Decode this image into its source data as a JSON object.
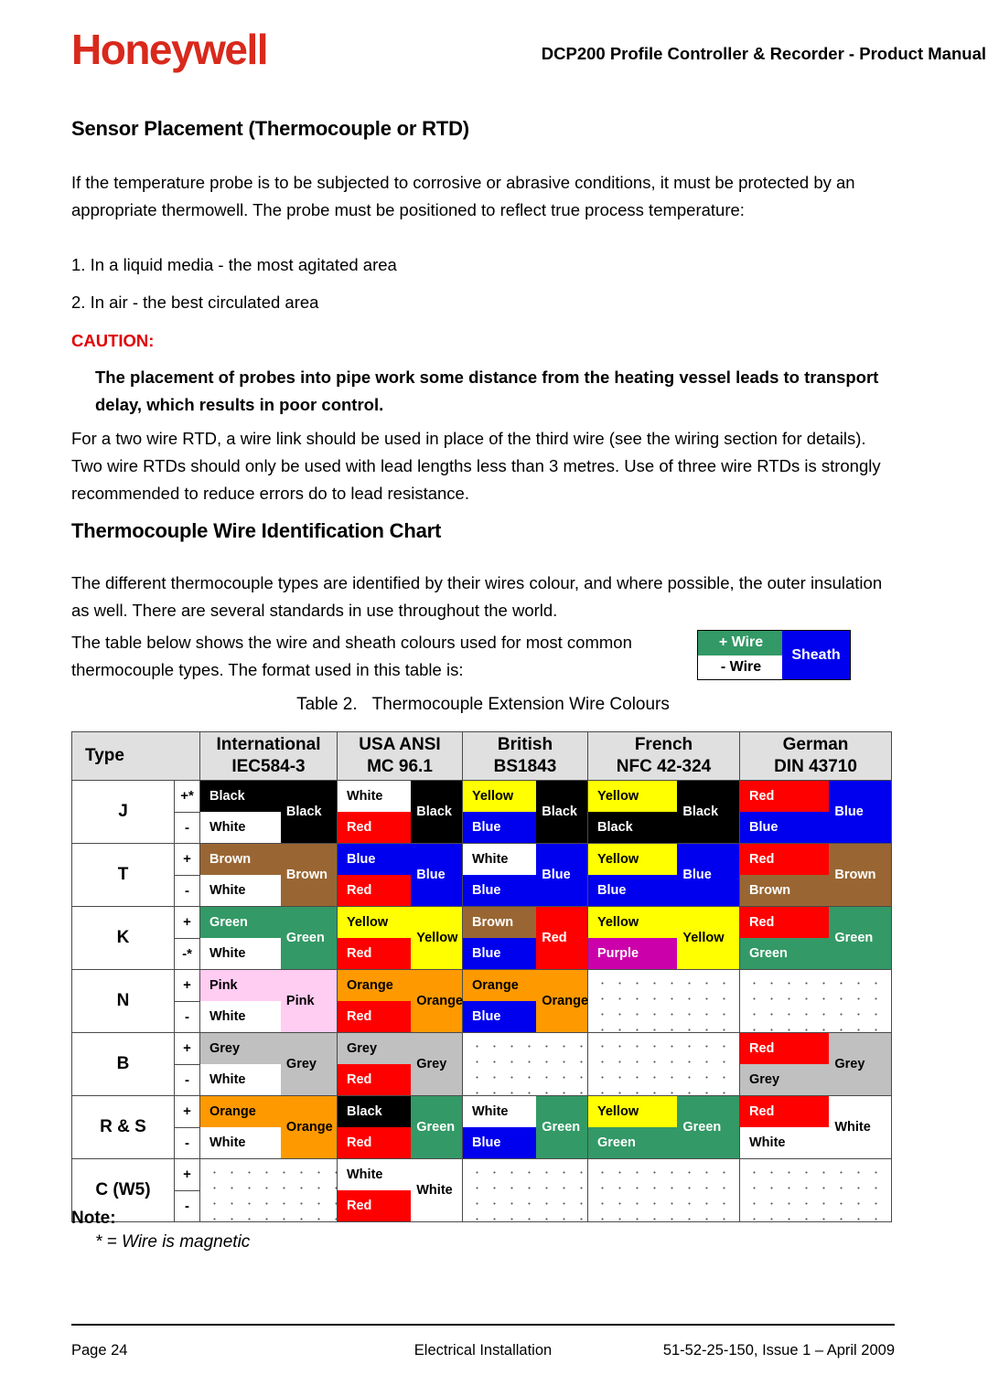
{
  "header": {
    "logo_text": "Honeywell",
    "logo_color": "#d8291c",
    "title": "DCP200 Profile Controller & Recorder - Product Manual"
  },
  "sections": {
    "sensor_placement": {
      "heading": "Sensor Placement (Thermocouple or RTD)",
      "intro": "If the temperature probe is to be subjected to corrosive or abrasive conditions, it must be protected by an appropriate thermowell. The probe must be positioned to reflect true process temperature:",
      "list": [
        "1. In a liquid media - the most agitated area",
        "2. In air - the best circulated area"
      ],
      "caution_label": "CAUTION:",
      "caution_color": "#e00000",
      "caution_body": "The placement of probes into pipe work some distance from the heating vessel leads to transport delay, which results in poor control.",
      "closing": "For a two wire RTD, a wire link should be used in place of the third wire (see the wiring section for details). Two wire RTDs should only be used with lead lengths less than 3 metres. Use of three wire RTDs is strongly recommended to reduce errors do to lead resistance."
    },
    "wire_chart": {
      "heading": "Thermocouple Wire Identification Chart",
      "para1": "The different thermocouple types are identified by their wires colour, and where possible, the outer insulation as well. There are several standards in use throughout the world.",
      "para2": "The table below shows the wire and sheath colours used for most common thermocouple types. The format used in this table is:"
    }
  },
  "legend": {
    "plus_label": "+ Wire",
    "minus_label": "- Wire",
    "sheath_label": "Sheath",
    "plus_color": "#339966",
    "minus_color": "#ffffff",
    "sheath_color": "#0000ee"
  },
  "table_caption": {
    "number": "Table 2.",
    "title": "Thermocouple Extension Wire Colours"
  },
  "palette": {
    "Black": "#000000",
    "White": "#ffffff",
    "Red": "#ff0000",
    "Blue": "#0000ee",
    "Yellow": "#ffff00",
    "Green": "#339966",
    "Brown": "#996633",
    "Pink": "#ffccf2",
    "Grey": "#c0c0c0",
    "Orange": "#ff9900",
    "Purple": "#cc00aa"
  },
  "table": {
    "columns": [
      {
        "l1": "Type",
        "l2": ""
      },
      {
        "l1": "International",
        "l2": "IEC584-3"
      },
      {
        "l1": "USA ANSI",
        "l2": "MC 96.1"
      },
      {
        "l1": "British",
        "l2": "BS1843"
      },
      {
        "l1": "French",
        "l2": "NFC 42-324"
      },
      {
        "l1": "German",
        "l2": "DIN 43710"
      }
    ],
    "rows": [
      {
        "type": "J",
        "plus_sign": "+*",
        "minus_sign": "-",
        "cells": [
          {
            "plus": "Black",
            "minus": "White",
            "sheath": "Black"
          },
          {
            "plus": "White",
            "minus": "Red",
            "sheath": "Black"
          },
          {
            "plus": "Yellow",
            "minus": "Blue",
            "sheath": "Black"
          },
          {
            "plus": "Yellow",
            "minus": "Black",
            "sheath": "Black"
          },
          {
            "plus": "Red",
            "minus": "Blue",
            "sheath": "Blue"
          }
        ]
      },
      {
        "type": "T",
        "plus_sign": "+",
        "minus_sign": "-",
        "cells": [
          {
            "plus": "Brown",
            "minus": "White",
            "sheath": "Brown"
          },
          {
            "plus": "Blue",
            "minus": "Red",
            "sheath": "Blue"
          },
          {
            "plus": "White",
            "minus": "Blue",
            "sheath": "Blue"
          },
          {
            "plus": "Yellow",
            "minus": "Blue",
            "sheath": "Blue"
          },
          {
            "plus": "Red",
            "minus": "Brown",
            "sheath": "Brown"
          }
        ]
      },
      {
        "type": "K",
        "plus_sign": "+",
        "minus_sign": "-*",
        "cells": [
          {
            "plus": "Green",
            "minus": "White",
            "sheath": "Green"
          },
          {
            "plus": "Yellow",
            "minus": "Red",
            "sheath": "Yellow"
          },
          {
            "plus": "Brown",
            "minus": "Blue",
            "sheath": "Red"
          },
          {
            "plus": "Yellow",
            "minus": "Purple",
            "sheath": "Yellow"
          },
          {
            "plus": "Red",
            "minus": "Green",
            "sheath": "Green"
          }
        ]
      },
      {
        "type": "N",
        "plus_sign": "+",
        "minus_sign": "-",
        "cells": [
          {
            "plus": "Pink",
            "minus": "White",
            "sheath": "Pink"
          },
          {
            "plus": "Orange",
            "minus": "Red",
            "sheath": "Orange"
          },
          {
            "plus": "Orange",
            "minus": "Blue",
            "sheath": "Orange"
          },
          {
            "empty": true
          },
          {
            "empty": true
          }
        ]
      },
      {
        "type": "B",
        "plus_sign": "+",
        "minus_sign": "-",
        "cells": [
          {
            "plus": "Grey",
            "minus": "White",
            "sheath": "Grey"
          },
          {
            "plus": "Grey",
            "minus": "Red",
            "sheath": "Grey"
          },
          {
            "empty": true
          },
          {
            "empty": true
          },
          {
            "plus": "Red",
            "minus": "Grey",
            "sheath": "Grey"
          }
        ]
      },
      {
        "type": "R & S",
        "plus_sign": "+",
        "minus_sign": "-",
        "cells": [
          {
            "plus": "Orange",
            "minus": "White",
            "sheath": "Orange"
          },
          {
            "plus": "Black",
            "minus": "Red",
            "sheath": "Green"
          },
          {
            "plus": "White",
            "minus": "Blue",
            "sheath": "Green"
          },
          {
            "plus": "Yellow",
            "minus": "Green",
            "sheath": "Green"
          },
          {
            "plus": "Red",
            "minus": "White",
            "sheath": "White"
          }
        ]
      },
      {
        "type": "C (W5)",
        "plus_sign": "+",
        "minus_sign": "-",
        "cells": [
          {
            "empty": true
          },
          {
            "plus": "White",
            "minus": "Red",
            "sheath": "White"
          },
          {
            "empty": true
          },
          {
            "empty": true
          },
          {
            "empty": true
          }
        ]
      }
    ]
  },
  "note": {
    "label": "Note:",
    "text": "* = Wire is magnetic"
  },
  "footer": {
    "left": "Page 24",
    "center": "Electrical Installation",
    "right": "51-52-25-150, Issue 1 – April 2009"
  }
}
